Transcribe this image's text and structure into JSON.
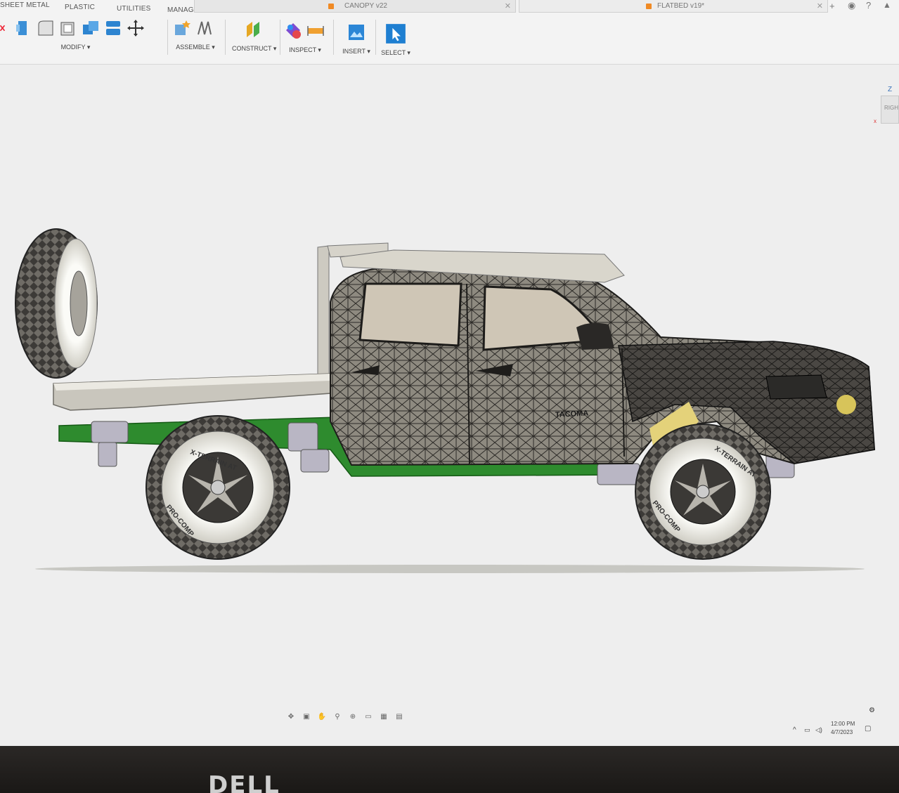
{
  "workspace_tabs": [
    "SHEET METAL",
    "PLASTIC",
    "UTILITIES",
    "MANAGE"
  ],
  "doc_tabs": [
    {
      "name": "CANOPY v22"
    },
    {
      "name": "FLATBED v19*"
    }
  ],
  "toolbar": {
    "modify": "MODIFY ▾",
    "assemble": "ASSEMBLE ▾",
    "construct": "CONSTRUCT ▾",
    "inspect": "INSPECT ▾",
    "insert": "INSERT ▾",
    "select": "SELECT ▾"
  },
  "viewcube": {
    "axis": "Z",
    "face": "RIGH"
  },
  "tire_text": {
    "brand": "PRO-COMP",
    "model": "X-TERRAIN AT"
  },
  "truck_badge": "TACOMA",
  "tray": {
    "time": "12:00 PM",
    "date": "4/7/2023"
  },
  "bezel_logo": "DELL",
  "colors": {
    "accent_blue": "#1f7fd1",
    "frame_green": "#2e8b2e",
    "mesh_dark": "#3a3835",
    "flatbed_grey": "#c9c6bd"
  }
}
